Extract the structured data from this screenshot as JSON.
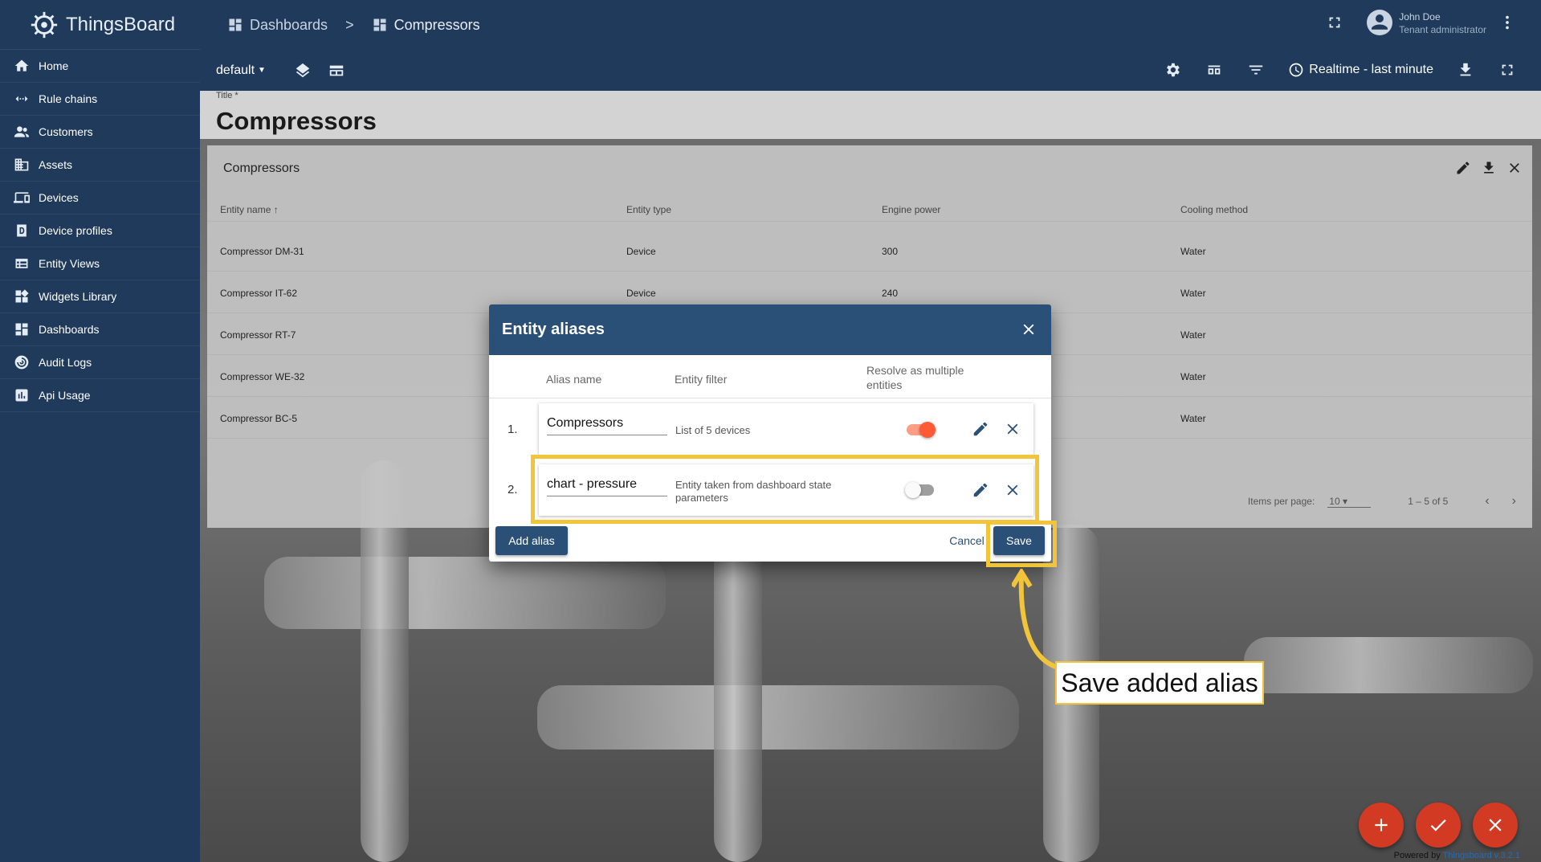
{
  "app": {
    "name": "ThingsBoard"
  },
  "sidebar": {
    "items": [
      {
        "label": "Home",
        "icon": "home-icon"
      },
      {
        "label": "Rule chains",
        "icon": "rule-chains-icon"
      },
      {
        "label": "Customers",
        "icon": "customers-icon"
      },
      {
        "label": "Assets",
        "icon": "assets-icon"
      },
      {
        "label": "Devices",
        "icon": "devices-icon"
      },
      {
        "label": "Device profiles",
        "icon": "device-profiles-icon"
      },
      {
        "label": "Entity Views",
        "icon": "entity-views-icon"
      },
      {
        "label": "Widgets Library",
        "icon": "widgets-library-icon"
      },
      {
        "label": "Dashboards",
        "icon": "dashboards-icon"
      },
      {
        "label": "Audit Logs",
        "icon": "audit-logs-icon"
      },
      {
        "label": "Api Usage",
        "icon": "api-usage-icon"
      }
    ]
  },
  "header": {
    "breadcrumb": [
      "Dashboards",
      ">",
      "Compressors"
    ],
    "user": {
      "name": "John Doe",
      "role": "Tenant administrator"
    }
  },
  "toolbar": {
    "state": "default",
    "timewindow": "Realtime - last minute"
  },
  "dashboard": {
    "title_label": "Title *",
    "title": "Compressors"
  },
  "widget": {
    "title": "Compressors",
    "columns": [
      "Entity name",
      "Entity type",
      "Engine power",
      "Cooling method"
    ],
    "sort_indicator": "↑",
    "rows": [
      [
        "Compressor DM-31",
        "Device",
        "300",
        "Water"
      ],
      [
        "Compressor IT-62",
        "Device",
        "240",
        "Water"
      ],
      [
        "Compressor RT-7",
        "",
        "",
        "Water"
      ],
      [
        "Compressor WE-32",
        "",
        "",
        "Water"
      ],
      [
        "Compressor BC-5",
        "",
        "",
        "Water"
      ]
    ],
    "pager": {
      "label": "Items per page:",
      "value": "10",
      "range": "1 – 5 of 5"
    }
  },
  "dialog": {
    "title": "Entity aliases",
    "columns": {
      "alias_name": "Alias name",
      "entity_filter": "Entity filter",
      "resolve": "Resolve as multiple entities"
    },
    "aliases": [
      {
        "num": "1.",
        "name": "Compressors",
        "filter": "List of 5 devices",
        "resolve_multiple": true
      },
      {
        "num": "2.",
        "name": "chart - pressure",
        "filter": "Entity taken from dashboard state parameters",
        "resolve_multiple": false
      }
    ],
    "add_label": "Add alias",
    "cancel_label": "Cancel",
    "save_label": "Save"
  },
  "annotation": {
    "callout": "Save added alias"
  },
  "footer": {
    "powered_prefix": "Powered by ",
    "powered_version": "Thingsboard v.3.2.1"
  },
  "colors": {
    "primary": "#2a5078",
    "accent": "#ff5a36",
    "highlight": "#f2c43a",
    "fab": "#d23a23"
  }
}
